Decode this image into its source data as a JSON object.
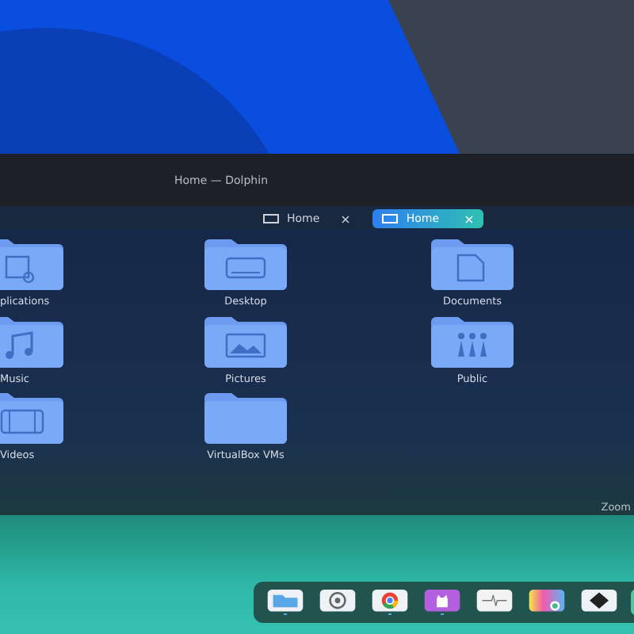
{
  "window": {
    "title": "Home — Dolphin"
  },
  "tabs": [
    {
      "label": "Home",
      "close": "×",
      "selected": false
    },
    {
      "label": "Home",
      "close": "×",
      "selected": true
    }
  ],
  "folders": [
    {
      "name": "plications",
      "kind": "applications"
    },
    {
      "name": "Desktop",
      "kind": "desktop"
    },
    {
      "name": "Documents",
      "kind": "documents"
    },
    {
      "name": "Music",
      "kind": "music"
    },
    {
      "name": "Pictures",
      "kind": "pictures"
    },
    {
      "name": "Public",
      "kind": "public"
    },
    {
      "name": "Videos",
      "kind": "videos"
    },
    {
      "name": "VirtualBox VMs",
      "kind": "plain"
    }
  ],
  "status_bar": {
    "zoom_label": "Zoom"
  },
  "dock": [
    {
      "kind": "files",
      "running": true
    },
    {
      "kind": "settings",
      "running": false
    },
    {
      "kind": "browser",
      "running": true
    },
    {
      "kind": "github",
      "running": true
    },
    {
      "kind": "monitor",
      "running": false
    },
    {
      "kind": "colors",
      "running": false
    },
    {
      "kind": "inkscape",
      "running": false
    },
    {
      "kind": "partial"
    }
  ]
}
